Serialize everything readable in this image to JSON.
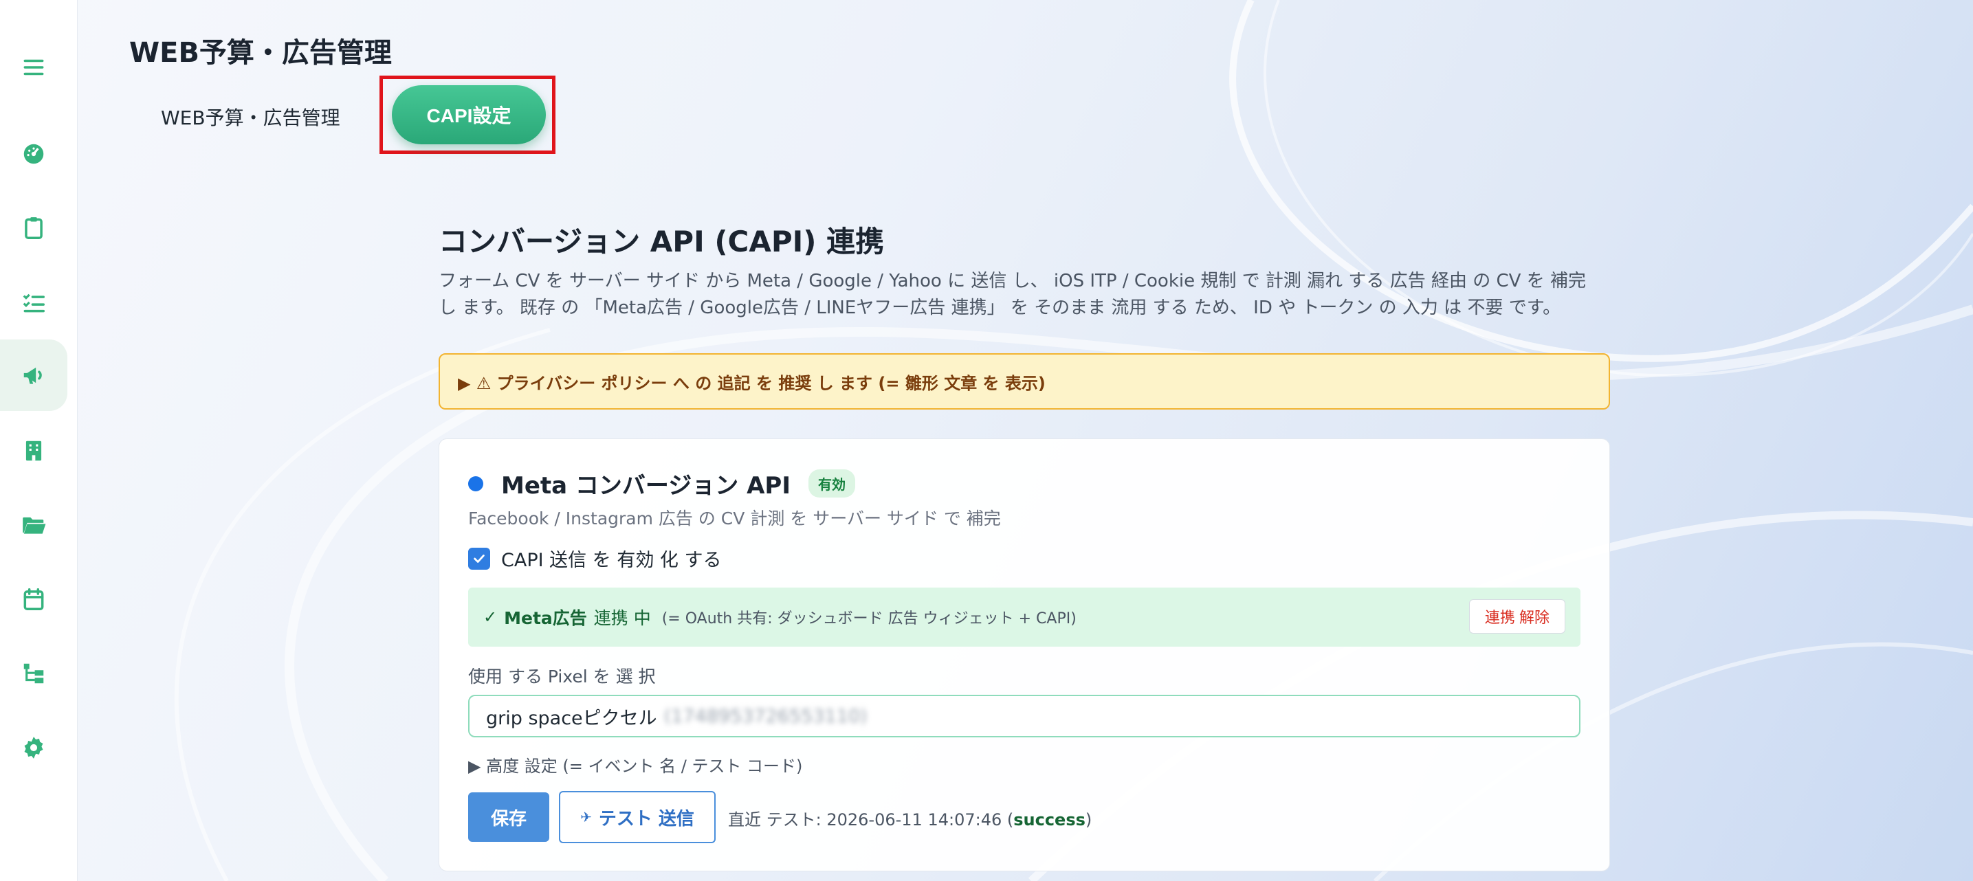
{
  "header": {
    "title": "WEB予算・広告管理",
    "tabs": [
      {
        "label": "WEB予算・広告管理",
        "active": false
      },
      {
        "label": "CAPI設定",
        "active": true
      }
    ]
  },
  "sidebar": {
    "items": [
      {
        "icon": "menu-icon"
      },
      {
        "icon": "dashboard-icon"
      },
      {
        "icon": "clipboard-icon"
      },
      {
        "icon": "checklist-icon"
      },
      {
        "icon": "megaphone-icon",
        "active": true
      },
      {
        "icon": "building-icon"
      },
      {
        "icon": "folder-open-icon"
      },
      {
        "icon": "calendar-icon"
      },
      {
        "icon": "hierarchy-icon"
      },
      {
        "icon": "gear-icon"
      }
    ]
  },
  "main": {
    "title": "コンバージョン API (CAPI) 連携",
    "description": "フォーム CV を サーバー サイド から Meta / Google / Yahoo に 送信 し、 iOS ITP / Cookie 規制 で 計測 漏れ する 広告 経由 の CV を 補完 し ます。 既存 の 「Meta広告 / Google広告 / LINEヤフー広告 連携」 を そのまま 流用 する ため、 ID や トークン の 入力 は 不要 です。",
    "privacy_notice": "▶ ⚠ プライバシー ポリシー へ の 追記 を 推奨 し ます (= 雛形 文章 を 表示)"
  },
  "meta_card": {
    "title": "Meta コンバージョン API",
    "badge": "有効",
    "subtitle": "Facebook / Instagram 広告 の CV 計測 を サーバー サイド で 補完",
    "enable_label": "CAPI 送信 を 有効 化 する",
    "enabled": true,
    "connection": {
      "check": "✓",
      "name": "Meta広告",
      "state": "連携 中",
      "note": "(= OAuth 共有: ダッシュボード 広告 ウィジェット + CAPI)",
      "unlink_label": "連携 解除"
    },
    "pixel_label": "使用 する Pixel を 選 択",
    "pixel_value": "grip spaceピクセル",
    "pixel_id_masked": "(1748953726553110)",
    "advanced_label": "▶ 高度 設定 (= イベント 名 / テスト コード)",
    "save_label": "保存",
    "test_icon": "✈",
    "test_label": "テスト 送信",
    "last_test_prefix": "直近 テスト: 2026-06-11 14:07:46 (",
    "last_test_status": "success",
    "last_test_suffix": ")"
  },
  "colors": {
    "accent_green": "#2aa878",
    "primary_blue": "#4a8fdc",
    "danger_red": "#d92d20",
    "highlight_red": "#e0141b"
  }
}
